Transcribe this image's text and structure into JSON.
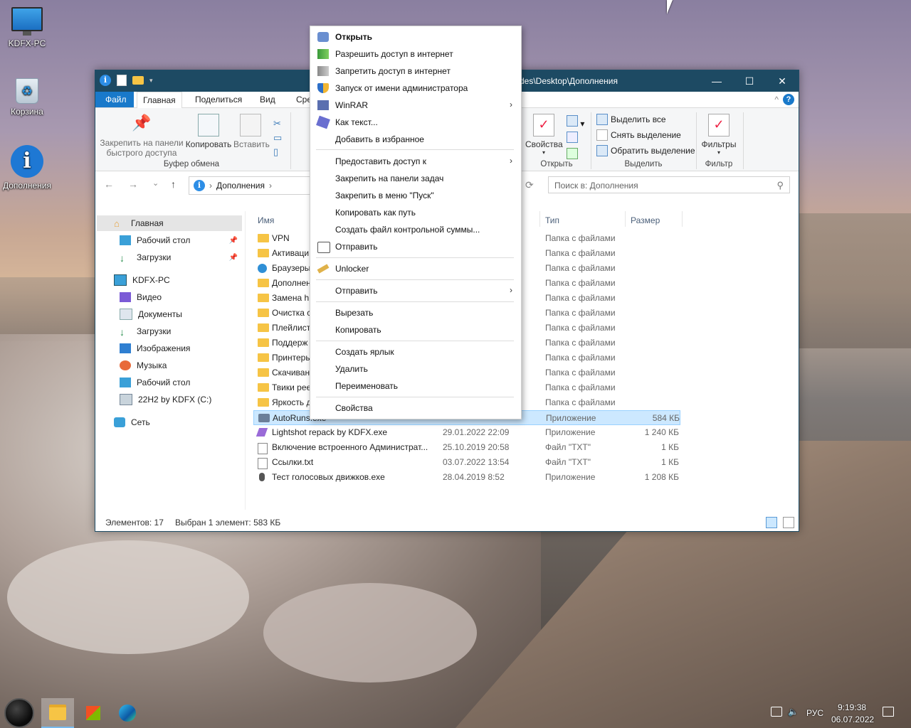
{
  "desktop": {
    "icons": [
      {
        "label": "KDFX-PC",
        "icon": "computer-icon"
      },
      {
        "label": "Корзина",
        "icon": "recycle-bin-icon"
      },
      {
        "label": "Дополнения",
        "icon": "info-icon"
      }
    ]
  },
  "window": {
    "title": "des\\Desktop\\Дополнения",
    "controls": {
      "minimize": "—",
      "maximize": "☐",
      "close": "✕"
    }
  },
  "ribbon": {
    "tabs": [
      "Файл",
      "Главная",
      "Поделиться",
      "Вид",
      "Сре"
    ],
    "clipboard": {
      "pin_label": "Закрепить на панели быстрого доступа",
      "copy_label": "Копировать",
      "paste_label": "Вставить",
      "group_label": "Буфер обмена"
    },
    "open": {
      "properties_label": "Свойства",
      "group_label": "Открыть"
    },
    "select": {
      "select_all": "Выделить все",
      "deselect": "Снять выделение",
      "invert": "Обратить выделение",
      "group_label": "Выделить"
    },
    "filter": {
      "filters_label": "Фильтры",
      "group_label": "Фильтр"
    }
  },
  "navigation": {
    "back": "←",
    "forward": "→",
    "recent": "⌄",
    "up": "↑",
    "address": "Дополнения",
    "address_chevron": "›",
    "refresh": "⟳",
    "search_placeholder": "Поиск в: Дополнения"
  },
  "sidebar": {
    "items": [
      {
        "label": "Главная",
        "icon": "home-icon"
      },
      {
        "label": "Рабочий стол",
        "icon": "desktop-icon"
      },
      {
        "label": "Загрузки",
        "icon": "download-icon"
      },
      {
        "label": "KDFX-PC",
        "icon": "computer-icon"
      },
      {
        "label": "Видео",
        "icon": "video-icon"
      },
      {
        "label": "Документы",
        "icon": "documents-icon"
      },
      {
        "label": "Загрузки",
        "icon": "download-icon"
      },
      {
        "label": "Изображения",
        "icon": "pictures-icon"
      },
      {
        "label": "Музыка",
        "icon": "music-icon"
      },
      {
        "label": "Рабочий стол",
        "icon": "desktop-icon"
      },
      {
        "label": "22H2 by KDFX (C:)",
        "icon": "drive-icon"
      },
      {
        "label": "Сеть",
        "icon": "network-icon"
      }
    ]
  },
  "files": {
    "headers": {
      "name": "Имя",
      "type": "Тип",
      "size": "Размер"
    },
    "rows": [
      {
        "name": "VPN",
        "date": "",
        "type": "Папка с файлами",
        "size": "",
        "kind": "folder"
      },
      {
        "name": "Активаци",
        "date": "",
        "type": "Папка с файлами",
        "size": "",
        "kind": "folder"
      },
      {
        "name": "Браузеры",
        "date": "",
        "type": "Папка с файлами",
        "size": "",
        "kind": "folder"
      },
      {
        "name": "Дополнен",
        "date": "",
        "type": "Папка с файлами",
        "size": "",
        "kind": "folder"
      },
      {
        "name": "Замена h",
        "date": "",
        "type": "Папка с файлами",
        "size": "",
        "kind": "folder"
      },
      {
        "name": "Очистка с",
        "date": "",
        "type": "Папка с файлами",
        "size": "",
        "kind": "folder"
      },
      {
        "name": "Плейлист",
        "date": "",
        "type": "Папка с файлами",
        "size": "",
        "kind": "folder"
      },
      {
        "name": "Поддерж",
        "date": "",
        "type": "Папка с файлами",
        "size": "",
        "kind": "folder"
      },
      {
        "name": "Принтеры",
        "date": "",
        "type": "Папка с файлами",
        "size": "",
        "kind": "folder"
      },
      {
        "name": "Скачиван",
        "date": "",
        "type": "Папка с файлами",
        "size": "",
        "kind": "folder"
      },
      {
        "name": "Твики рее",
        "date": "",
        "type": "Папка с файлами",
        "size": "",
        "kind": "folder"
      },
      {
        "name": "Яркость д",
        "date": "",
        "type": "Папка с файлами",
        "size": "",
        "kind": "folder"
      },
      {
        "name": "AutoRuns.exe",
        "date": "",
        "type": "Приложение",
        "size": "584 КБ",
        "kind": "exe"
      },
      {
        "name": "Lightshot repack by KDFX.exe",
        "date": "29.01.2022 22:09",
        "type": "Приложение",
        "size": "1 240 КБ",
        "kind": "exe"
      },
      {
        "name": "Включение встроенного Администрат...",
        "date": "25.10.2019 20:58",
        "type": "Файл \"TXT\"",
        "size": "1 КБ",
        "kind": "txt"
      },
      {
        "name": "Ссылки.txt",
        "date": "03.07.2022 13:54",
        "type": "Файл \"TXT\"",
        "size": "1 КБ",
        "kind": "txt"
      },
      {
        "name": "Тест голосовых движков.exe",
        "date": "28.04.2019 8:52",
        "type": "Приложение",
        "size": "1 208 КБ",
        "kind": "exe"
      }
    ]
  },
  "status": {
    "count": "Элементов: 17",
    "selected": "Выбран 1 элемент: 583 КБ"
  },
  "context_menu": {
    "items": [
      {
        "label": "Открыть",
        "icon": "open-icon",
        "bold": true
      },
      {
        "label": "Разрешить доступ в интернет",
        "icon": "signal-green-icon"
      },
      {
        "label": "Запретить доступ в интернет",
        "icon": "signal-grey-icon"
      },
      {
        "label": "Запуск от имени администратора",
        "icon": "shield-icon"
      },
      {
        "label": "WinRAR",
        "icon": "winrar-icon",
        "submenu": true
      },
      {
        "label": "Как текст...",
        "icon": "text-icon"
      },
      {
        "label": "Добавить в избранное"
      },
      {
        "label": "Предоставить доступ к",
        "submenu": true
      },
      {
        "label": "Закрепить на панели задач"
      },
      {
        "label": "Закрепить в меню \"Пуск\""
      },
      {
        "label": "Копировать как путь"
      },
      {
        "label": "Создать файл контрольной суммы..."
      },
      {
        "label": "Отправить",
        "icon": "share-icon"
      },
      {
        "label": "Unlocker",
        "icon": "unlocker-icon"
      },
      {
        "label": "Отправить",
        "submenu": true
      },
      {
        "label": "Вырезать"
      },
      {
        "label": "Копировать"
      },
      {
        "label": "Создать ярлык"
      },
      {
        "label": "Удалить"
      },
      {
        "label": "Переименовать"
      },
      {
        "label": "Свойства"
      }
    ],
    "submenu_arrow": "›"
  },
  "taskbar": {
    "language": "РУС",
    "time": "9:19:38",
    "date": "06.07.2022"
  }
}
